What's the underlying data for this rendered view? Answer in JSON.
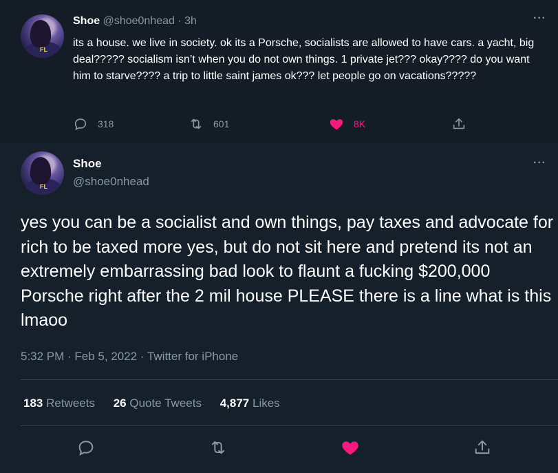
{
  "parent_tweet": {
    "name": "Shoe",
    "handle": "@shoe0nhead",
    "separator": "·",
    "time": "3h",
    "more": "···",
    "text": "its a house. we live in society. ok its a Porsche, socialists are allowed to have cars. a yacht, big deal????? socialism isn’t when you do not own things. 1 private jet??? okay???? do you want him to starve???? a trip to little saint james ok??? let people go on vacations?????",
    "replies": "318",
    "retweets": "601",
    "likes": "8K",
    "icons": [
      "reply-icon",
      "retweet-icon",
      "like-icon",
      "share-icon"
    ],
    "like_color": "#f91880"
  },
  "main_tweet": {
    "name": "Shoe",
    "handle": "@shoe0nhead",
    "more": "···",
    "text": "yes you can be a socialist and own things, pay taxes and advocate for rich to be taxed more yes, but do not sit here and pretend its not an extremely embarrassing bad look to flaunt a fucking $200,000 Porsche right after the 2 mil house PLEASE there is a line what is this lmaoo",
    "meta": "5:32 PM · Feb 5, 2022 · Twitter for iPhone",
    "stats": {
      "retweets_count": "183",
      "retweets_label": "Retweets",
      "quotes_count": "26",
      "quotes_label": "Quote Tweets",
      "likes_count": "4,877",
      "likes_label": "Likes"
    },
    "icons": [
      "reply-icon",
      "retweet-icon",
      "like-icon",
      "share-icon"
    ]
  },
  "colors": {
    "background": "#15202b",
    "secondary_text": "#8899a6",
    "like_pink": "#f91880",
    "divider": "#38444d"
  }
}
